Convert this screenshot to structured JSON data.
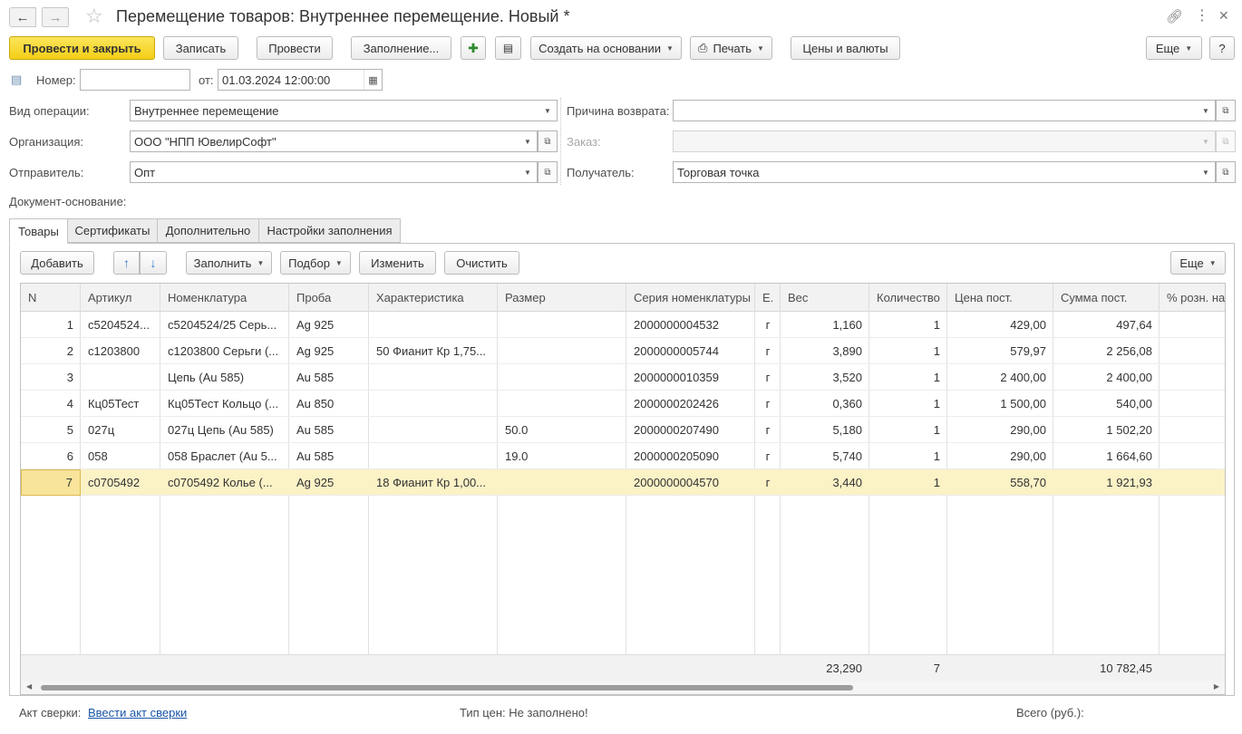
{
  "window": {
    "title": "Перемещение товаров: Внутреннее перемещение. Новый *"
  },
  "toolbar": {
    "post_close": "Провести и закрыть",
    "save": "Записать",
    "post": "Провести",
    "fill": "Заполнение...",
    "create_based": "Создать на основании",
    "print": "Печать",
    "prices_currency": "Цены и валюты",
    "more": "Еще",
    "help": "?"
  },
  "header": {
    "number_label": "Номер:",
    "number_value": "",
    "date_label": "от:",
    "date_value": "01.03.2024 12:00:00"
  },
  "form": {
    "operation_label": "Вид операции:",
    "operation_value": "Внутреннее перемещение",
    "org_label": "Организация:",
    "org_value": "ООО \"НПП ЮвелирСофт\"",
    "sender_label": "Отправитель:",
    "sender_value": "Опт",
    "return_reason_label": "Причина возврата:",
    "return_reason_value": "",
    "order_label": "Заказ:",
    "order_value": "",
    "receiver_label": "Получатель:",
    "receiver_value": "Торговая точка",
    "basis_label": "Документ-основание:"
  },
  "tabs": [
    {
      "label": "Товары"
    },
    {
      "label": "Сертификаты"
    },
    {
      "label": "Дополнительно"
    },
    {
      "label": "Настройки заполнения"
    }
  ],
  "grid_toolbar": {
    "add": "Добавить",
    "fill": "Заполнить",
    "selection": "Подбор",
    "change": "Изменить",
    "clear": "Очистить",
    "more": "Еще"
  },
  "table": {
    "columns": [
      "N",
      "Артикул",
      "Номенклатура",
      "Проба",
      "Характеристика",
      "Размер",
      "Серия номенклатуры",
      "Е.",
      "Вес",
      "Количество",
      "Цена пост.",
      "Сумма пост.",
      "% розн. на"
    ],
    "rows": [
      [
        "1",
        "c5204524...",
        "c5204524/25 Серь...",
        "Ag 925",
        "",
        "",
        "2000000004532",
        "г",
        "1,160",
        "1",
        "429,00",
        "497,64",
        ""
      ],
      [
        "2",
        "c1203800",
        "c1203800 Серьги (...",
        "Ag 925",
        "50 Фианит Кр 1,75...",
        "",
        "2000000005744",
        "г",
        "3,890",
        "1",
        "579,97",
        "2 256,08",
        ""
      ],
      [
        "3",
        "",
        "Цепь (Au 585)",
        "Au 585",
        "",
        "",
        "2000000010359",
        "г",
        "3,520",
        "1",
        "2 400,00",
        "2 400,00",
        ""
      ],
      [
        "4",
        "Кц05Тест",
        "Кц05Тест Кольцо (...",
        "Au 850",
        "",
        "",
        "2000000202426",
        "г",
        "0,360",
        "1",
        "1 500,00",
        "540,00",
        ""
      ],
      [
        "5",
        "027ц",
        "027ц Цепь (Au 585)",
        "Au 585",
        "",
        "50.0",
        "2000000207490",
        "г",
        "5,180",
        "1",
        "290,00",
        "1 502,20",
        ""
      ],
      [
        "6",
        "058",
        "058 Браслет (Au 5...",
        "Au 585",
        "",
        "19.0",
        "2000000205090",
        "г",
        "5,740",
        "1",
        "290,00",
        "1 664,60",
        ""
      ],
      [
        "7",
        "c0705492",
        "c0705492 Колье (...",
        "Ag 925",
        "18 Фианит Кр 1,00...",
        "",
        "2000000004570",
        "г",
        "3,440",
        "1",
        "558,70",
        "1 921,93",
        ""
      ]
    ],
    "totals": {
      "weight": "23,290",
      "quantity": "7",
      "sum": "10 782,45"
    }
  },
  "footer": {
    "act_label": "Акт сверки:",
    "act_link": "Ввести акт сверки",
    "price_type": "Тип цен: Не заполнено!",
    "total_label": "Всего (руб.):"
  }
}
